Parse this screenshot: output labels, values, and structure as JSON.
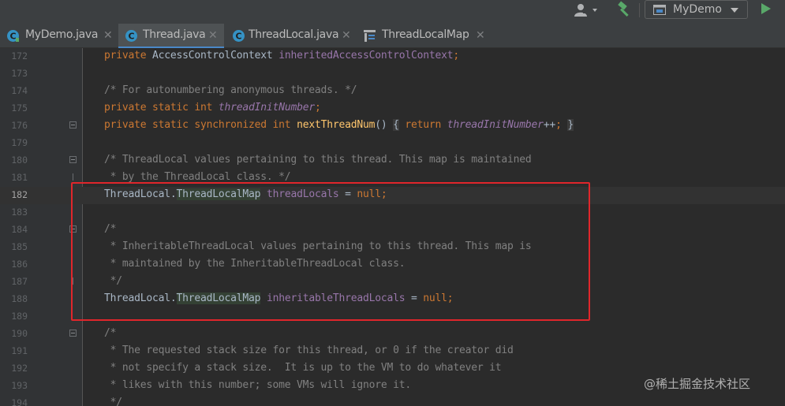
{
  "toolbar": {
    "run_config": "MyDemo",
    "colors": {
      "run": "#59a869",
      "build": "#59a869"
    }
  },
  "tabs": [
    {
      "label": "MyDemo.java",
      "icon": "java-class-icon",
      "active": false
    },
    {
      "label": "Thread.java",
      "icon": "java-class-icon",
      "active": true
    },
    {
      "label": "ThreadLocal.java",
      "icon": "java-class-icon",
      "active": false
    },
    {
      "label": "ThreadLocalMap",
      "icon": "structure-icon",
      "active": false
    }
  ],
  "editor": {
    "current_line": "182",
    "lines": [
      {
        "num": "172",
        "code": "private AccessControlContext inheritedAccessControlContext;"
      },
      {
        "num": "173",
        "code": ""
      },
      {
        "num": "174",
        "code": "/* For autonumbering anonymous threads. */"
      },
      {
        "num": "175",
        "code": "private static int threadInitNumber;"
      },
      {
        "num": "176",
        "code": "private static synchronized int nextThreadNum() { return threadInitNumber++; }"
      },
      {
        "num": "179",
        "code": ""
      },
      {
        "num": "180",
        "code": "/* ThreadLocal values pertaining to this thread. This map is maintained"
      },
      {
        "num": "181",
        "code": " * by the ThreadLocal class. */"
      },
      {
        "num": "182",
        "code": "ThreadLocal.ThreadLocalMap threadLocals = null;"
      },
      {
        "num": "183",
        "code": ""
      },
      {
        "num": "184",
        "code": "/*"
      },
      {
        "num": "185",
        "code": " * InheritableThreadLocal values pertaining to this thread. This map is"
      },
      {
        "num": "186",
        "code": " * maintained by the InheritableThreadLocal class."
      },
      {
        "num": "187",
        "code": " */"
      },
      {
        "num": "188",
        "code": "ThreadLocal.ThreadLocalMap inheritableThreadLocals = null;"
      },
      {
        "num": "189",
        "code": ""
      },
      {
        "num": "190",
        "code": "/*"
      },
      {
        "num": "191",
        "code": " * The requested stack size for this thread, or 0 if the creator did"
      },
      {
        "num": "192",
        "code": " * not specify a stack size.  It is up to the VM to do whatever it"
      },
      {
        "num": "193",
        "code": " * likes with this number; some VMs will ignore it."
      },
      {
        "num": "194",
        "code": " */"
      }
    ]
  },
  "watermark": "@稀土掘金技术社区",
  "colors": {
    "highlight_box": "#e0262b",
    "keyword": "#cc7832",
    "comment": "#808080",
    "field": "#9876aa",
    "method": "#ffc66d"
  }
}
